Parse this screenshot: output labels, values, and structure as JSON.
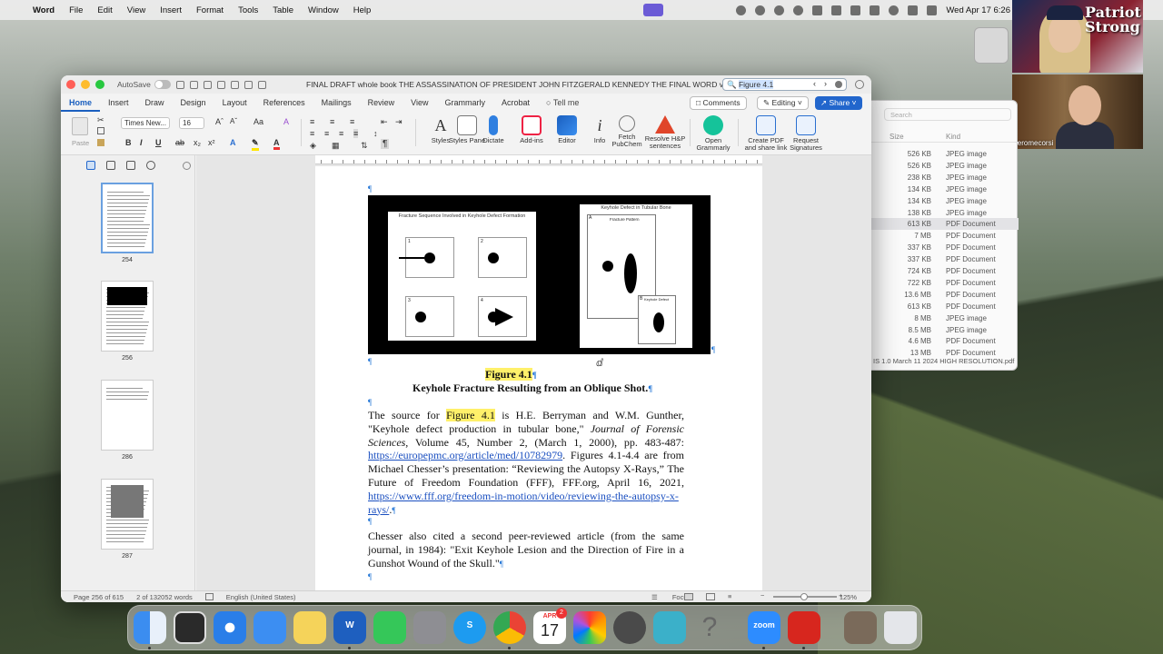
{
  "menubar": {
    "app": "Word",
    "items": [
      "File",
      "Edit",
      "View",
      "Insert",
      "Format",
      "Tools",
      "Table",
      "Window",
      "Help"
    ],
    "clock": "Wed Apr 17  6:26"
  },
  "zoom": {
    "tile1_logo": "Patriot Strong",
    "tile2_name": "jeromecorsi"
  },
  "finder": {
    "search_placeholder": "Search",
    "col_size": "Size",
    "col_kind": "Kind",
    "rows": [
      {
        "size": "526 KB",
        "kind": "JPEG image"
      },
      {
        "size": "526 KB",
        "kind": "JPEG image"
      },
      {
        "size": "238 KB",
        "kind": "JPEG image"
      },
      {
        "size": "134 KB",
        "kind": "JPEG image"
      },
      {
        "size": "134 KB",
        "kind": "JPEG image"
      },
      {
        "size": "138 KB",
        "kind": "JPEG image"
      },
      {
        "size": "613 KB",
        "kind": "PDF Document"
      },
      {
        "size": "7 MB",
        "kind": "PDF Document"
      },
      {
        "size": "337 KB",
        "kind": "PDF Document"
      },
      {
        "size": "337 KB",
        "kind": "PDF Document"
      },
      {
        "size": "724 KB",
        "kind": "PDF Document"
      },
      {
        "size": "722 KB",
        "kind": "PDF Document"
      },
      {
        "size": "13.6 MB",
        "kind": "PDF Document"
      },
      {
        "size": "613 KB",
        "kind": "PDF Document"
      },
      {
        "size": "8 MB",
        "kind": "JPEG image"
      },
      {
        "size": "8.5 MB",
        "kind": "JPEG image"
      },
      {
        "size": "4.6 MB",
        "kind": "PDF Document"
      },
      {
        "size": "13 MB",
        "kind": "PDF Document"
      }
    ],
    "path": "IS 1.0 March 11 2024 HIGH RESOLUTION.pdf"
  },
  "word": {
    "autosave_label": "AutoSave",
    "doc_title": "FINAL DRAFT whole book THE ASSASSINATION OF PRESIDENT JOHN FITZGERALD KENNEDY THE FINAL WORD ver...",
    "search_value": "Figure 4.1",
    "tabs": [
      "Home",
      "Insert",
      "Draw",
      "Design",
      "Layout",
      "References",
      "Mailings",
      "Review",
      "View",
      "Grammarly",
      "Acrobat"
    ],
    "tell_me": "Tell me",
    "comments_label": "Comments",
    "editing_label": "Editing",
    "share_label": "Share",
    "font_name": "Times New...",
    "font_size": "16",
    "paste_label": "Paste",
    "ribbon_buttons": [
      "Styles",
      "Styles Pane",
      "Dictate",
      "Add-ins",
      "Editor",
      "Info",
      "Fetch PubChem",
      "Resolve H&P sentences",
      "Open Grammarly",
      "Create PDF and share link",
      "Request Signatures"
    ],
    "thumbs": [
      {
        "page": "254"
      },
      {
        "page": "256"
      },
      {
        "page": "286"
      },
      {
        "page": "287"
      }
    ],
    "figure": {
      "left_title": "Fracture Sequence Involved in Keyhole Defect Formation",
      "right_title": "Keyhole Defect in Tubular Bone",
      "right_sub1": "Fracture Pattern",
      "right_sub2": "Keyhole Defect",
      "cells": [
        "1",
        "2",
        "3",
        "4"
      ],
      "corner_a": "A",
      "corner_b": "B"
    },
    "caption_label": "Figure 4.1",
    "caption_title": "Keyhole Fracture Resulting from an Oblique Shot.",
    "para1": {
      "a": "The source for ",
      "hl": "Figure 4.1",
      "b": " is H.E. Berryman and W.M. Gunther, \"Keyhole defect production in tubular bone,\" ",
      "journal": "Journal of Forensic Sciences,",
      "c": " Volume 45, Number 2, (March 1, 2000), pp. 483-487: ",
      "link1": "https://europepmc.org/article/med/10782979",
      "d": ". Figures 4.1-4.4 are from Michael Chesser’s presentation: “Reviewing the Autopsy X-Rays,” The Future of Freedom Foundation (FFF), FFF.org, April 16, 2021, ",
      "link2": "https://www.fff.org/freedom-in-motion/video/reviewing-the-autopsy-x-rays/",
      "e": "."
    },
    "para2": "Chesser also cited a second peer-reviewed article (from the same journal, in 1984): \"Exit Keyhole Lesion and the Direction of Fire in a Gunshot Wound of the Skull.\"",
    "status": {
      "page": "Page 256 of 615",
      "words": "2 of 132052 words",
      "language": "English (United States)",
      "focus": "Focus",
      "zoom": "125%"
    }
  },
  "dock": {
    "zoom_label": "zoom",
    "calendar_month": "APR",
    "calendar_day": "17",
    "calendar_badge": "2"
  }
}
